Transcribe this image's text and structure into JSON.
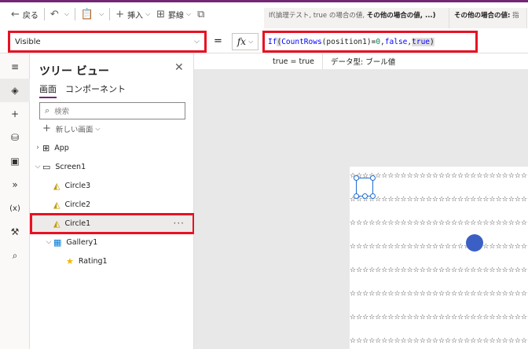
{
  "toolbar": {
    "back_label": "戻る",
    "insert_label": "挿入",
    "border_label": "罫線"
  },
  "formula_tabs": [
    {
      "prefix": "If(論理テスト, true の場合の値, ",
      "bold": "その他の場合の値, ...)"
    },
    {
      "prefix": "",
      "bold": "その他の場合の値:",
      "suffix": " 指"
    }
  ],
  "formula_bar": {
    "property": "Visible",
    "equals": "=",
    "fx_label": "fx",
    "formula_parts": {
      "fn1": "If",
      "open1": "(",
      "fn2": "CountRows",
      "arg": "(position1)=",
      "num": "0",
      "mid": ", ",
      "kw1": "false",
      "sep": ", ",
      "kw2": "true",
      "close": ")"
    }
  },
  "hint": {
    "result": "true = true",
    "datatype": "データ型: ブール値"
  },
  "rail": [
    "hamburger-icon",
    "layers-icon",
    "plus-icon",
    "database-icon",
    "media-icon",
    "power-automate-icon",
    "variables-icon",
    "tools-icon",
    "search-icon"
  ],
  "rail_labels": {
    "variables": "(x)"
  },
  "tree": {
    "title": "ツリー ビュー",
    "tab_screens": "画面",
    "tab_components": "コンポーネント",
    "search_placeholder": "検索",
    "new_screen": "新しい画面",
    "nodes": {
      "app": "App",
      "screen1": "Screen1",
      "circle3": "Circle3",
      "circle2": "Circle2",
      "circle1": "Circle1",
      "gallery1": "Gallery1",
      "rating1": "Rating1"
    },
    "more": "···"
  },
  "stars": "☆☆☆☆☆☆☆☆☆☆☆☆☆☆☆☆☆☆☆☆☆☆☆☆☆☆☆☆☆☆☆☆",
  "colors": {
    "accent": "#742774",
    "highlight_red": "#e81123",
    "selection_blue": "#1e6fd1",
    "circle_blue": "#3b5fc4"
  }
}
